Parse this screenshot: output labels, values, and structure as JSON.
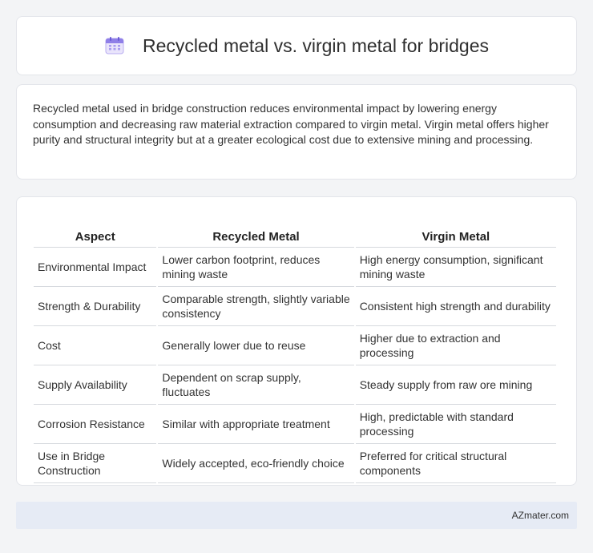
{
  "header": {
    "title": "Recycled metal vs. virgin metal for bridges",
    "icon": "calendar-icon"
  },
  "description": "Recycled metal used in bridge construction reduces environmental impact by lowering energy consumption and decreasing raw material extraction compared to virgin metal. Virgin metal offers higher purity and structural integrity but at a greater ecological cost due to extensive mining and processing.",
  "table": {
    "headers": [
      "Aspect",
      "Recycled Metal",
      "Virgin Metal"
    ],
    "rows": [
      [
        "Environmental Impact",
        "Lower carbon footprint, reduces mining waste",
        "High energy consumption, significant mining waste"
      ],
      [
        "Strength & Durability",
        "Comparable strength, slightly variable consistency",
        "Consistent high strength and durability"
      ],
      [
        "Cost",
        "Generally lower due to reuse",
        "Higher due to extraction and processing"
      ],
      [
        "Supply Availability",
        "Dependent on scrap supply, fluctuates",
        "Steady supply from raw ore mining"
      ],
      [
        "Corrosion Resistance",
        "Similar with appropriate treatment",
        "High, predictable with standard processing"
      ],
      [
        "Use in Bridge Construction",
        "Widely accepted, eco-friendly choice",
        "Preferred for critical structural components"
      ]
    ]
  },
  "footer": {
    "brand": "AZmater.com"
  }
}
